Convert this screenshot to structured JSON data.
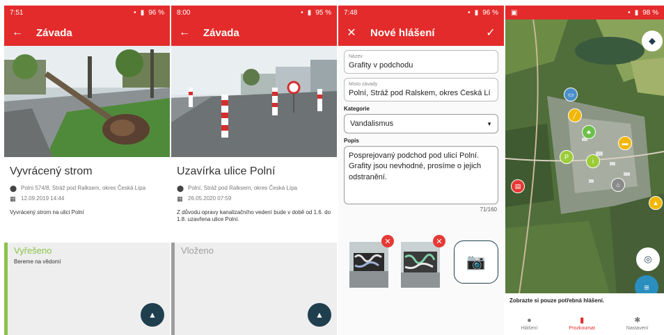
{
  "screen1": {
    "status": {
      "time": "7:51",
      "battery": "96 %"
    },
    "appbar": {
      "title": "Závada"
    },
    "title": "Vyvrácený strom",
    "address": "Polní 574/8, Stráž pod Ralksem, okres Česká Lípa",
    "date": "12.09.2019 14:44",
    "description": "Vyvrácený strom na ulici Polní",
    "state": "Vyřešeno",
    "state_note": "Bereme na vědomí",
    "state_color": "#8bc34a"
  },
  "screen2": {
    "status": {
      "time": "8:00",
      "battery": "95 %"
    },
    "appbar": {
      "title": "Závada"
    },
    "title": "Uzavírka ulice Polní",
    "address": "Polní, Stráž pod Ralksem, okres Česká Lípa",
    "date": "26.05.2020 07:59",
    "description": "Z důvodu opravy kanalizačního vedení bude v době od 1.6. do 1.8. uzavřena ulice Polní.",
    "state": "Vloženo",
    "state_color": "#9e9e9e"
  },
  "screen3": {
    "status": {
      "time": "7:48",
      "battery": "96 %"
    },
    "appbar": {
      "title": "Nové hlášení"
    },
    "name_label": "Název",
    "name_value": "Grafity v podchodu",
    "place_label": "Místo závady",
    "place_value": "Polní, Stráž pod Ralskem, okres Česká Lí",
    "category_label": "Kategorie",
    "category_value": "Vandalismus",
    "desc_label": "Popis",
    "desc_value": "Posprejovaný podchod pod ulicí Polní. Grafity jsou nevhodné, prosíme o jejich odstranění.",
    "counter": "71/160"
  },
  "screen4": {
    "status": {
      "battery": "98 %"
    },
    "hint": "Zobrazte si pouze potřebná hlášení.",
    "nav": [
      {
        "label": "Hlášení",
        "icon": "report-icon"
      },
      {
        "label": "Prozkoumat",
        "icon": "map-icon"
      },
      {
        "label": "Nastavení",
        "icon": "settings-icon"
      }
    ]
  },
  "colors": {
    "accent": "#e32b2b",
    "dark": "#1f3f4f"
  }
}
